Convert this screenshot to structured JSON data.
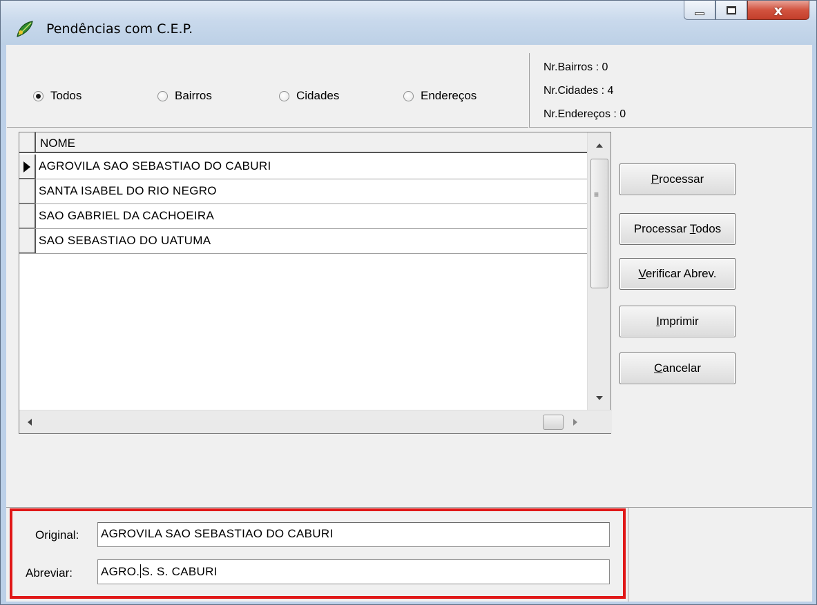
{
  "window": {
    "title": "Pendências com C.E.P.",
    "icon": "app-leaf-icon",
    "close_glyph": "x"
  },
  "filters": {
    "options": [
      {
        "label": "Todos",
        "checked": true
      },
      {
        "label": "Bairros",
        "checked": false
      },
      {
        "label": "Cidades",
        "checked": false
      },
      {
        "label": "Endereços",
        "checked": false
      }
    ]
  },
  "counts": {
    "bairros": "Nr.Bairros  : 0",
    "cidades": "Nr.Cidades  : 4",
    "enderecos": "Nr.Endereços : 0"
  },
  "grid": {
    "column": "NOME",
    "rows": [
      "AGROVILA SAO SEBASTIAO DO CABURI",
      "SANTA ISABEL DO RIO NEGRO",
      "SAO GABRIEL DA CACHOEIRA",
      "SAO SEBASTIAO DO UATUMA"
    ],
    "selected_row": 0
  },
  "buttons": {
    "processar": {
      "before": "",
      "accel": "P",
      "after": "rocessar"
    },
    "processar_todos": {
      "before": "Processar ",
      "accel": "T",
      "after": "odos"
    },
    "verificar": {
      "before": "",
      "accel": "V",
      "after": "erificar Abrev."
    },
    "imprimir": {
      "before": "",
      "accel": "I",
      "after": "mprimir"
    },
    "cancelar": {
      "before": "",
      "accel": "C",
      "after": "ancelar"
    }
  },
  "fields": {
    "original_label": "Original:",
    "original_value": "AGROVILA SAO SEBASTIAO DO CABURI",
    "abreviar_label": "Abreviar:",
    "abreviar_before_caret": "AGRO.",
    "abreviar_after_caret": "S. S. CABURI"
  },
  "colors": {
    "highlight": "#e01818"
  }
}
